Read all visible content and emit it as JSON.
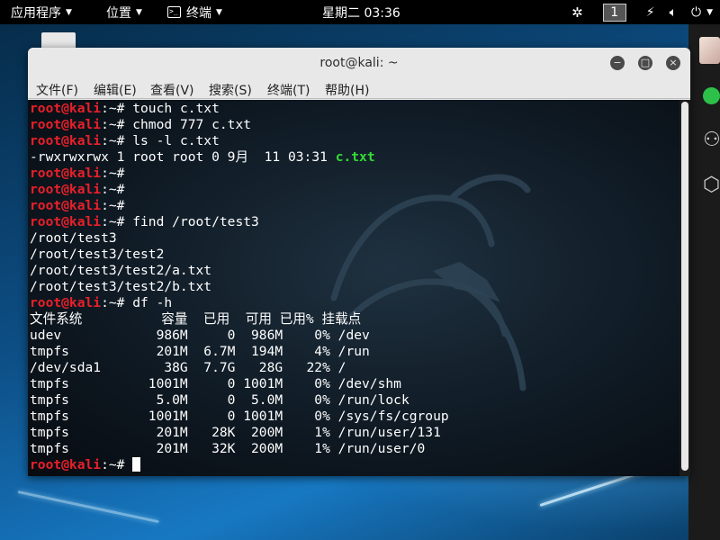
{
  "top_panel": {
    "apps_label": "应用程序",
    "places_label": "位置",
    "terminal_label": "终端",
    "clock": "星期二 03:36",
    "workspace": "1"
  },
  "window": {
    "title": "root@kali: ~",
    "menus": [
      "文件(F)",
      "编辑(E)",
      "查看(V)",
      "搜索(S)",
      "终端(T)",
      "帮助(H)"
    ]
  },
  "terminal": {
    "prompt_user": "root@kali",
    "prompt_suffix": ":~# ",
    "lines": [
      {
        "type": "cmd",
        "text": "touch c.txt"
      },
      {
        "type": "cmd",
        "text": "chmod 777 c.txt"
      },
      {
        "type": "cmd",
        "text": "ls -l c.txt"
      },
      {
        "type": "lsout",
        "text": "-rwxrwxrwx 1 root root 0 9月  11 03:31 ",
        "file": "c.txt"
      },
      {
        "type": "cmd",
        "text": ""
      },
      {
        "type": "cmd",
        "text": ""
      },
      {
        "type": "cmd",
        "text": ""
      },
      {
        "type": "cmd",
        "text": "find /root/test3"
      },
      {
        "type": "out",
        "text": "/root/test3"
      },
      {
        "type": "out",
        "text": "/root/test3/test2"
      },
      {
        "type": "out",
        "text": "/root/test3/test2/a.txt"
      },
      {
        "type": "out",
        "text": "/root/test3/test2/b.txt"
      },
      {
        "type": "cmd",
        "text": "df -h"
      },
      {
        "type": "out",
        "text": "文件系统          容量  已用  可用 已用% 挂载点"
      },
      {
        "type": "out",
        "text": "udev            986M     0  986M    0% /dev"
      },
      {
        "type": "out",
        "text": "tmpfs           201M  6.7M  194M    4% /run"
      },
      {
        "type": "out",
        "text": "/dev/sda1        38G  7.7G   28G   22% /"
      },
      {
        "type": "out",
        "text": "tmpfs          1001M     0 1001M    0% /dev/shm"
      },
      {
        "type": "out",
        "text": "tmpfs           5.0M     0  5.0M    0% /run/lock"
      },
      {
        "type": "out",
        "text": "tmpfs          1001M     0 1001M    0% /sys/fs/cgroup"
      },
      {
        "type": "out",
        "text": "tmpfs           201M   28K  200M    1% /run/user/131"
      },
      {
        "type": "out",
        "text": "tmpfs           201M   32K  200M    1% /run/user/0"
      },
      {
        "type": "cmd",
        "text": "",
        "cursor": true
      }
    ]
  },
  "colors": {
    "prompt_user": "#e8202a",
    "file_green": "#32dc32",
    "terminal_bg": "#0f1a24"
  }
}
